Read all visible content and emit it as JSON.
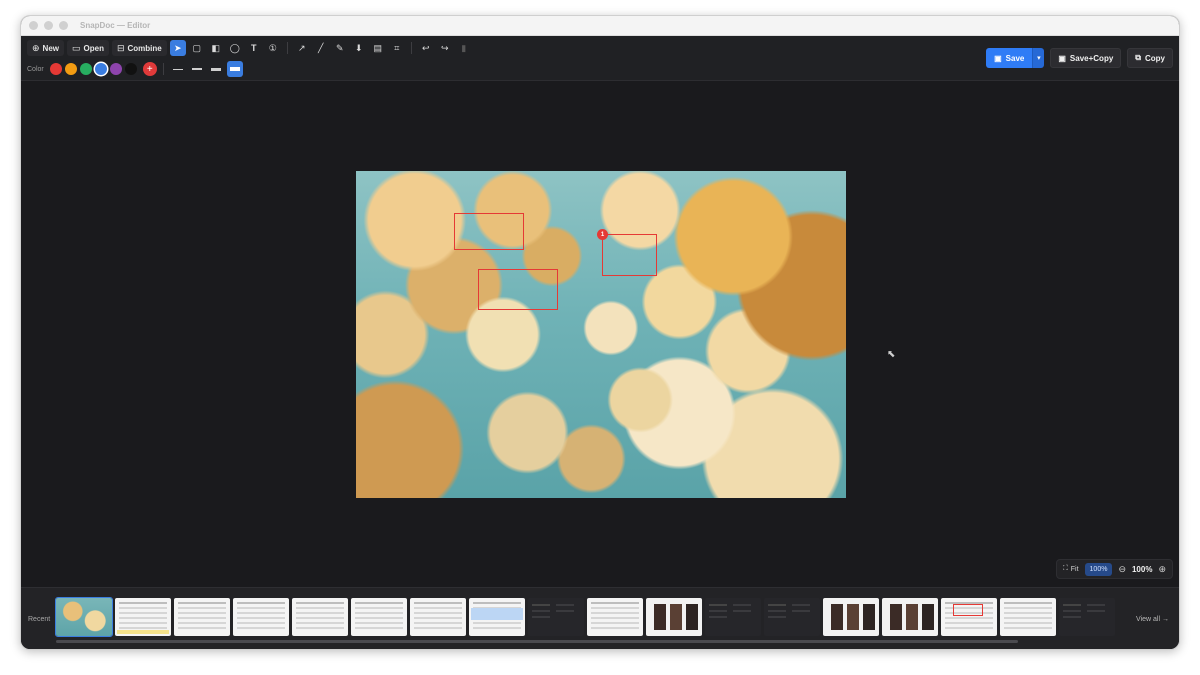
{
  "window": {
    "title": "SnapDoc — Editor"
  },
  "toolbar": {
    "new_label": "New",
    "open_label": "Open",
    "combine_label": "Combine",
    "color_label": "Color",
    "colors": [
      "#e53935",
      "#f39c12",
      "#27ae60",
      "#3a7de0",
      "#8e44ad",
      "#111111"
    ],
    "selected_color": "#3a7de0",
    "tools": [
      "select-icon",
      "rectangle-icon",
      "highlight-box-icon",
      "ellipse-icon",
      "text-icon",
      "step-number-icon",
      "arrow-icon",
      "line-icon",
      "pen-icon",
      "marker-icon",
      "blur-icon",
      "crop-icon",
      "undo-icon",
      "redo-icon",
      "trash-icon"
    ],
    "active_tool": "select-icon"
  },
  "actions": {
    "save_label": "Save",
    "save_copy_label": "Save+Copy",
    "copy_label": "Copy"
  },
  "canvas": {
    "annotation_badge": "1"
  },
  "zoom": {
    "fit_label": "Fit",
    "preset_label": "100%",
    "value": "100%"
  },
  "recent": {
    "label": "Recent",
    "view_all_label": "View all →"
  }
}
